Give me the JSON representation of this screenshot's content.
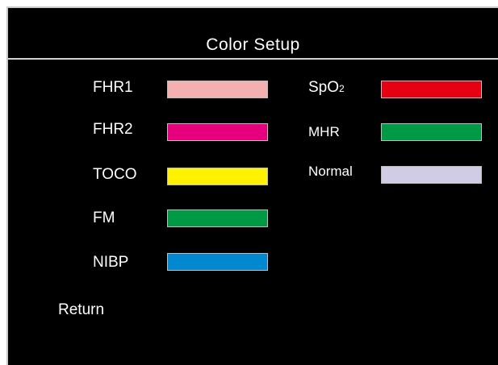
{
  "dialog": {
    "title": "Color Setup"
  },
  "left_items": [
    {
      "label": "FHR1",
      "color": "#f4b0b0"
    },
    {
      "label": "FHR2",
      "color": "#e6007e"
    },
    {
      "label": "TOCO",
      "color": "#fff200"
    },
    {
      "label": "FM",
      "color": "#009a44"
    },
    {
      "label": "NIBP",
      "color": "#0089d0"
    }
  ],
  "right_items": [
    {
      "label": "SpO",
      "label_sub": "2",
      "color": "#e50012"
    },
    {
      "label": "MHR",
      "color": "#009a44"
    },
    {
      "label": "Normal",
      "color": "#d0cce6"
    }
  ],
  "return_label": "Return"
}
